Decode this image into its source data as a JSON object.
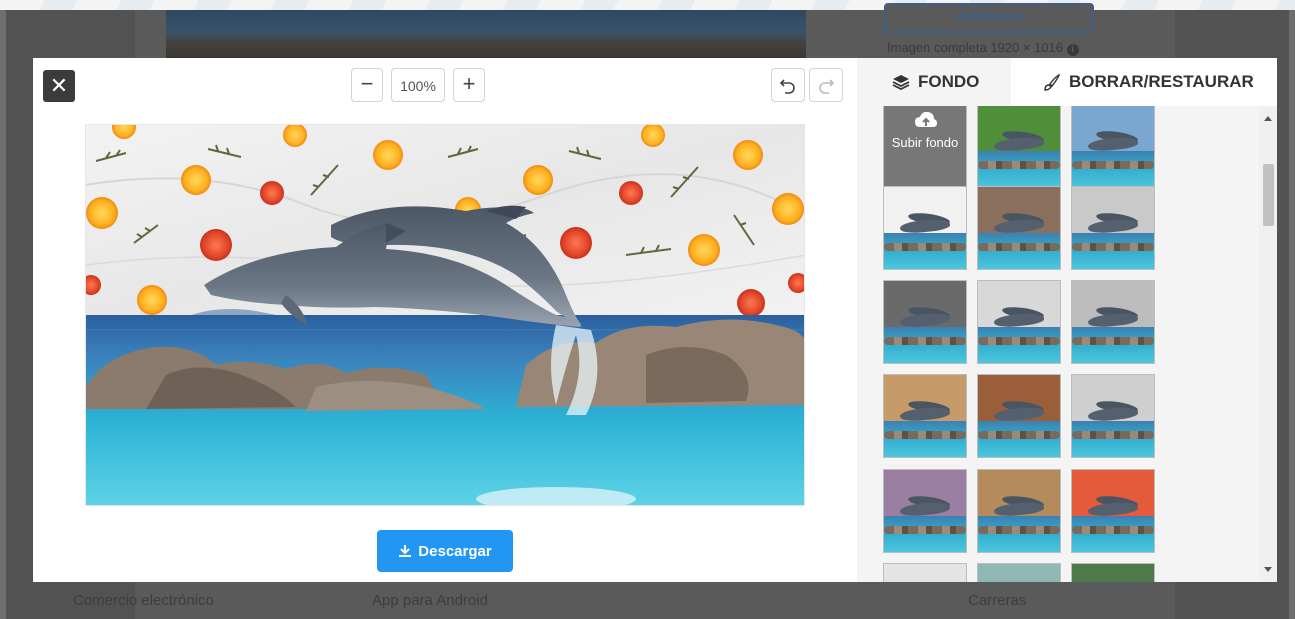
{
  "background_page": {
    "hd_button_label": "definición",
    "full_image_text": "Imagen completa 1920 × 1016",
    "info_icon": "info-circle-icon",
    "footer_links": [
      "Comercio electrónico",
      "App para Android",
      "Carreras"
    ]
  },
  "toolbar": {
    "close_icon": "close-icon",
    "zoom_out_label": "−",
    "zoom_value": "100%",
    "zoom_in_label": "+",
    "undo_icon": "undo-icon",
    "redo_icon": "redo-icon"
  },
  "download": {
    "label": "Descargar",
    "icon": "download-icon"
  },
  "panel": {
    "tabs": [
      {
        "label": "FONDO",
        "icon": "layers-icon",
        "active": true
      },
      {
        "label": "BORRAR/RESTAURAR",
        "icon": "brush-icon",
        "active": false
      }
    ],
    "upload_label": "Subir fondo",
    "upload_icon": "cloud-upload-icon",
    "backgrounds": [
      {
        "name": "green-leaves",
        "top": "#4f8f3a"
      },
      {
        "name": "water",
        "top": "#7aa7d0"
      },
      {
        "name": "fruits-marble",
        "top": "#f1f1f1"
      },
      {
        "name": "brick-wall",
        "top": "#8a6f5c"
      },
      {
        "name": "grey-wall",
        "top": "#c9c9c9"
      },
      {
        "name": "studio-dark",
        "top": "#6a6a6a"
      },
      {
        "name": "grey-studio",
        "top": "#d8d8d8"
      },
      {
        "name": "grey-gradient",
        "top": "#bdbdbd"
      },
      {
        "name": "food-veggies",
        "top": "#c79a6a"
      },
      {
        "name": "wood-wall",
        "top": "#9a5e3b"
      },
      {
        "name": "light-grey",
        "top": "#cfcfcf"
      },
      {
        "name": "purple",
        "top": "#9a7fa3"
      },
      {
        "name": "wood-planks",
        "top": "#b58b5e"
      },
      {
        "name": "rainbow-stripes",
        "top": "#e45a3a"
      },
      {
        "name": "white-room",
        "top": "#e4e4e4"
      },
      {
        "name": "bokeh",
        "top": "#8fb7b3"
      },
      {
        "name": "palm-trees",
        "top": "#4d7a48"
      }
    ]
  }
}
